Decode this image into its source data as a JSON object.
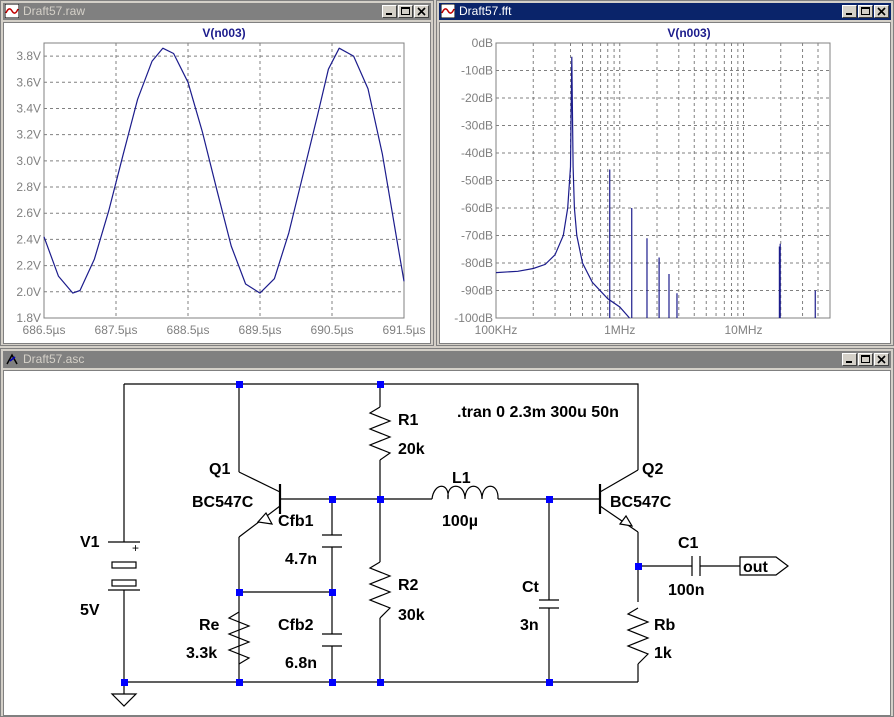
{
  "windows": {
    "raw": {
      "title": "Draft57.raw"
    },
    "fft": {
      "title": "Draft57.fft"
    },
    "asc": {
      "title": "Draft57.asc"
    }
  },
  "raw_plot": {
    "trace_label": "V(n003)",
    "y_ticks": [
      "1.8V",
      "2.0V",
      "2.2V",
      "2.4V",
      "2.6V",
      "2.8V",
      "3.0V",
      "3.2V",
      "3.4V",
      "3.6V",
      "3.8V"
    ],
    "x_ticks": [
      "686.5µs",
      "687.5µs",
      "688.5µs",
      "689.5µs",
      "690.5µs",
      "691.5µs"
    ],
    "trace_color": "#1c1c8c"
  },
  "fft_plot": {
    "trace_label": "V(n003)",
    "y_ticks": [
      "0dB",
      "-10dB",
      "-20dB",
      "-30dB",
      "-40dB",
      "-50dB",
      "-60dB",
      "-70dB",
      "-80dB",
      "-90dB",
      "-100dB"
    ],
    "x_ticks": [
      "100KHz",
      "1MHz",
      "10MHz"
    ],
    "trace_color": "#1c1c8c"
  },
  "chart_data": [
    {
      "type": "line",
      "title": "V(n003)",
      "xlabel": "",
      "ylabel": "",
      "x_unit": "µs",
      "y_unit": "V",
      "xlim": [
        686.5,
        691.5
      ],
      "ylim": [
        1.8,
        3.9
      ],
      "grid": true,
      "series": [
        {
          "name": "V(n003)",
          "x": [
            686.5,
            686.7,
            686.9,
            687.0,
            687.2,
            687.4,
            687.6,
            687.8,
            688.0,
            688.15,
            688.3,
            688.5,
            688.7,
            688.9,
            689.1,
            689.3,
            689.5,
            689.7,
            689.9,
            690.1,
            690.3,
            690.45,
            690.6,
            690.8,
            691.0,
            691.2,
            691.4,
            691.5
          ],
          "y": [
            2.42,
            2.12,
            1.99,
            2.01,
            2.25,
            2.62,
            3.05,
            3.47,
            3.76,
            3.86,
            3.82,
            3.6,
            3.22,
            2.78,
            2.35,
            2.06,
            1.99,
            2.1,
            2.45,
            2.9,
            3.35,
            3.7,
            3.86,
            3.8,
            3.55,
            3.05,
            2.4,
            2.08
          ]
        }
      ]
    },
    {
      "type": "line",
      "title": "V(n003)",
      "xlabel": "",
      "ylabel": "",
      "x_unit": "Hz",
      "y_unit": "dB",
      "x_scale": "log",
      "xlim": [
        100000,
        50000000
      ],
      "ylim": [
        -100,
        0
      ],
      "grid": true,
      "series": [
        {
          "name": "V(n003)",
          "x": [
            100000,
            150000,
            200000,
            250000,
            300000,
            350000,
            380000,
            400000,
            410000,
            420000,
            430000,
            450000,
            500000,
            600000,
            800000,
            1000000,
            1200000
          ],
          "y": [
            -83.5,
            -83.0,
            -82.0,
            -80.5,
            -77.0,
            -70.0,
            -60.0,
            -45.0,
            -5.0,
            -45.0,
            -60.0,
            -70.0,
            -80.0,
            -87.0,
            -93.0,
            -96.0,
            -100.0
          ]
        },
        {
          "name": "harmonics",
          "x": [
            830000,
            1250000,
            1660000,
            2080000,
            2500000,
            2900000,
            19500000,
            19800000,
            38000000
          ],
          "y": [
            -46.0,
            -60.0,
            -71.0,
            -78.0,
            -84.0,
            -91.0,
            -74.0,
            -73.0,
            -90.0
          ]
        }
      ]
    }
  ],
  "schematic": {
    "directive": ".tran 0 2.3m 300u 50n",
    "components": {
      "v1": {
        "name": "V1",
        "value": "5V",
        "plus": "+"
      },
      "q1": {
        "name": "Q1",
        "model": "BC547C"
      },
      "q2": {
        "name": "Q2",
        "model": "BC547C"
      },
      "r1": {
        "name": "R1",
        "value": "20k"
      },
      "r2": {
        "name": "R2",
        "value": "30k"
      },
      "re": {
        "name": "Re",
        "value": "3.3k"
      },
      "rb": {
        "name": "Rb",
        "value": "1k"
      },
      "l1": {
        "name": "L1",
        "value": "100µ"
      },
      "cfb1": {
        "name": "Cfb1",
        "value": "4.7n"
      },
      "cfb2": {
        "name": "Cfb2",
        "value": "6.8n"
      },
      "ct": {
        "name": "Ct",
        "value": "3n"
      },
      "c1": {
        "name": "C1",
        "value": "100n"
      }
    },
    "net_label": "out"
  }
}
